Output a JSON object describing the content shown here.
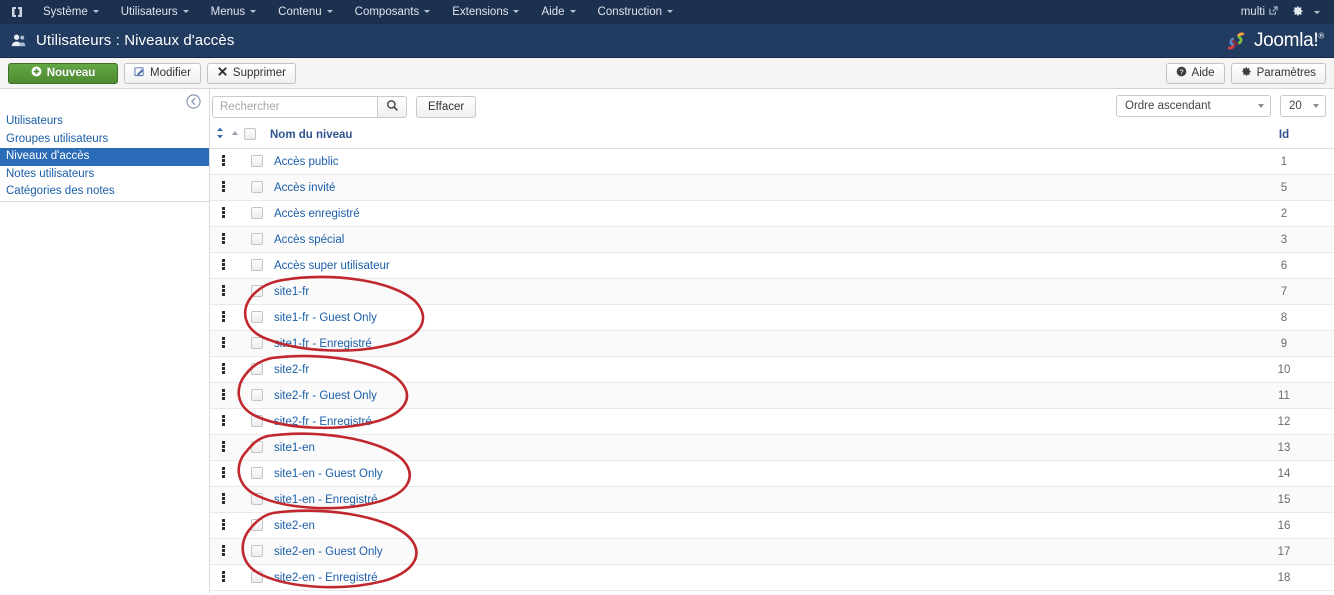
{
  "colors": {
    "topbar_bg": "#1c3050",
    "subheader_bg": "#223b61",
    "accent_blue": "#1a5ea8",
    "active_nav": "#2b6cb9",
    "primary_green": "#4e8a33",
    "annotation_red": "#c0282d"
  },
  "topbar": {
    "logo_icon": "joomla-brand-icon",
    "menu": [
      {
        "label": "Système",
        "has_caret": true
      },
      {
        "label": "Utilisateurs",
        "has_caret": true
      },
      {
        "label": "Menus",
        "has_caret": true
      },
      {
        "label": "Contenu",
        "has_caret": true
      },
      {
        "label": "Composants",
        "has_caret": true
      },
      {
        "label": "Extensions",
        "has_caret": true
      },
      {
        "label": "Aide",
        "has_caret": true
      },
      {
        "label": "Construction",
        "has_caret": true
      }
    ],
    "site_link": "multi",
    "site_link_icon": "external-link-icon",
    "gear_icon": "gear-icon"
  },
  "subheader": {
    "page_icon": "users-icon",
    "title": "Utilisateurs : Niveaux d'accès",
    "brand_text": "Joomla!",
    "brand_sup": "®",
    "brand_icon": "joomla-logo-icon"
  },
  "toolbar": {
    "new_label": "Nouveau",
    "edit_label": "Modifier",
    "delete_label": "Supprimer",
    "help_label": "Aide",
    "options_label": "Paramètres",
    "new_icon": "circle-plus-icon",
    "edit_icon": "pencil-icon",
    "delete_icon": "x-icon",
    "help_icon": "question-circle-icon",
    "options_icon": "gear-icon"
  },
  "sidebar": {
    "collapse_icon": "collapse-left-icon",
    "items": [
      {
        "label": "Utilisateurs",
        "active": false
      },
      {
        "label": "Groupes utilisateurs",
        "active": false
      },
      {
        "label": "Niveaux d'accès",
        "active": true
      },
      {
        "label": "Notes utilisateurs",
        "active": false
      },
      {
        "label": "Catégories des notes",
        "active": false
      }
    ]
  },
  "filters": {
    "search_placeholder": "Rechercher",
    "search_value": "",
    "search_icon": "search-icon",
    "clear_label": "Effacer",
    "order_value": "Ordre ascendant",
    "limit_value": "20"
  },
  "table": {
    "headers": {
      "order": "",
      "check": "",
      "name": "Nom du niveau",
      "id": "Id"
    },
    "sort_icons": [
      "sort-updown-icon",
      "sort-asc-icon"
    ],
    "rows": [
      {
        "name": "Accès public",
        "id": "1"
      },
      {
        "name": "Accès invité",
        "id": "5"
      },
      {
        "name": "Accès enregistré",
        "id": "2"
      },
      {
        "name": "Accès spécial",
        "id": "3"
      },
      {
        "name": "Accès super utilisateur",
        "id": "6"
      },
      {
        "name": "site1-fr",
        "id": "7"
      },
      {
        "name": "site1-fr - Guest Only",
        "id": "8"
      },
      {
        "name": "site1-fr - Enregistré",
        "id": "9"
      },
      {
        "name": "site2-fr",
        "id": "10"
      },
      {
        "name": "site2-fr - Guest Only",
        "id": "11"
      },
      {
        "name": "site2-fr - Enregistré",
        "id": "12"
      },
      {
        "name": "site1-en",
        "id": "13"
      },
      {
        "name": "site1-en - Guest Only",
        "id": "14"
      },
      {
        "name": "site1-en - Enregistré",
        "id": "15"
      },
      {
        "name": "site2-en",
        "id": "16"
      },
      {
        "name": "site2-en - Guest Only",
        "id": "17"
      },
      {
        "name": "site2-en - Enregistré",
        "id": "18"
      }
    ]
  },
  "annotations": {
    "description": "hand-drawn red ellipses circling grouped access level rows",
    "groups": [
      "site1-fr group",
      "site2-fr group",
      "site1-en group",
      "site2-en group"
    ]
  }
}
